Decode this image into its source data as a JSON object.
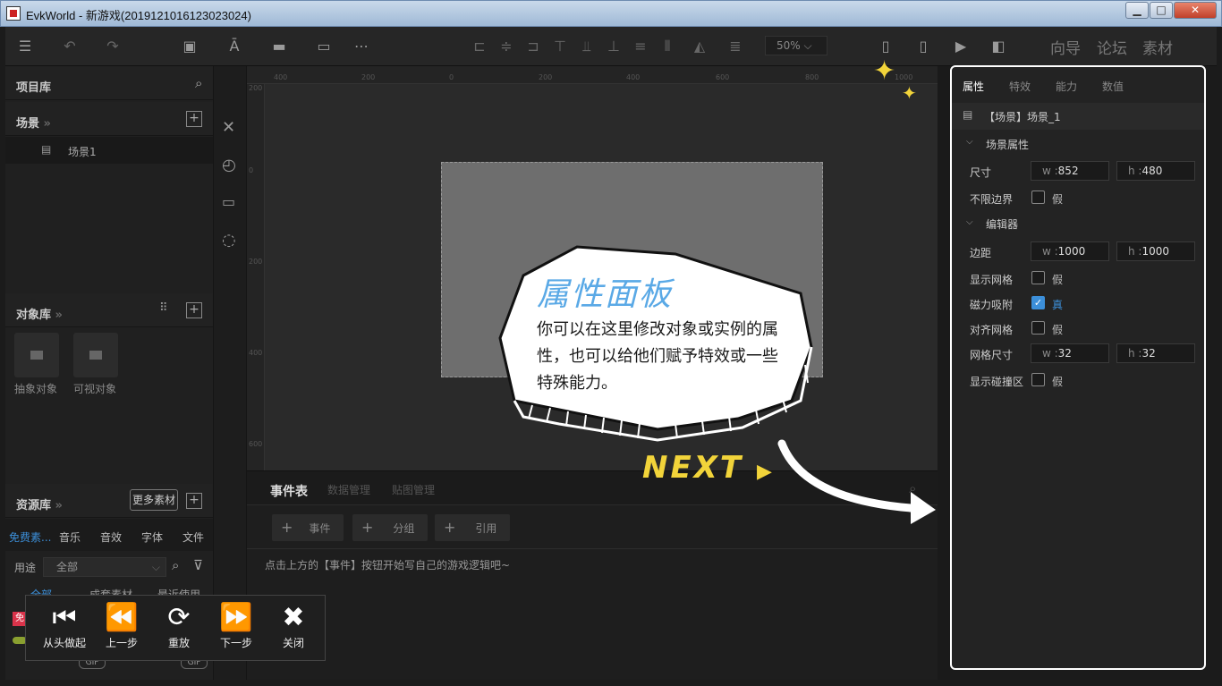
{
  "window": {
    "title": "EvkWorld - 新游戏(20191210161230​23024)",
    "minimize": "▁",
    "maximize": "□",
    "close": "✕"
  },
  "toolbar": {
    "zoom": "50%",
    "zoom_arrow": "⌵",
    "links": [
      "向导",
      "论坛",
      "素材"
    ]
  },
  "project": {
    "title": "项目库",
    "scene_header": "场景",
    "scene_item": "场景1"
  },
  "objects": {
    "title": "对象库",
    "items": [
      "抽象对象",
      "可视对象"
    ]
  },
  "resources": {
    "title": "资源库",
    "more_button": "更多素材",
    "tabs": [
      "免费素...",
      "音乐",
      "音效",
      "字体",
      "文件"
    ],
    "filter_label": "用途",
    "filter_value": "全部",
    "subtabs": [
      "全部",
      "成套素材",
      "最近使用"
    ],
    "free_badge": "免",
    "gif1": "GIF",
    "gif2": "GIF"
  },
  "ruler": {
    "h": [
      "400",
      "200",
      "0",
      "200",
      "400",
      "600",
      "800",
      "1000"
    ],
    "v": [
      "200",
      "0",
      "200",
      "400",
      "600"
    ]
  },
  "events": {
    "tabs": [
      "事件表",
      "数据管理",
      "贴图管理"
    ],
    "buttons": [
      "事件",
      "分组",
      "引用"
    ],
    "hint": "点击上方的【事件】按钮开始写自己的游戏逻辑吧~"
  },
  "props": {
    "tabs": [
      "属性",
      "特效",
      "能力",
      "数值"
    ],
    "header": "【场景】场景_1",
    "section1": "场景属性",
    "size_label": "尺寸",
    "size_w": "852",
    "size_h": "480",
    "unbounded_label": "不限边界",
    "unbounded_value": "假",
    "section2": "编辑器",
    "margin_label": "边距",
    "margin_w": "1000",
    "margin_h": "1000",
    "showgrid_label": "显示网格",
    "showgrid_value": "假",
    "snap_label": "磁力吸附",
    "snap_value": "真",
    "aligngrid_label": "对齐网格",
    "aligngrid_value": "假",
    "gridsize_label": "网格尺寸",
    "grid_w": "32",
    "grid_h": "32",
    "showcollision_label": "显示碰撞区",
    "showcollision_value": "假",
    "w_key": "w :",
    "h_key": "h :"
  },
  "tip": {
    "title": "属性面板",
    "body": "你可以在这里修改对象或实例的属性，也可以给他们赋予特效或一些特殊能力。",
    "next": "NEXT"
  },
  "tutorial": {
    "buttons": [
      "从头做起",
      "上一步",
      "重放",
      "下一步",
      "关闭"
    ]
  },
  "colors": {
    "accent": "#3c8fd9",
    "next": "#f2d43a",
    "tip_title": "#5aa9e6"
  }
}
